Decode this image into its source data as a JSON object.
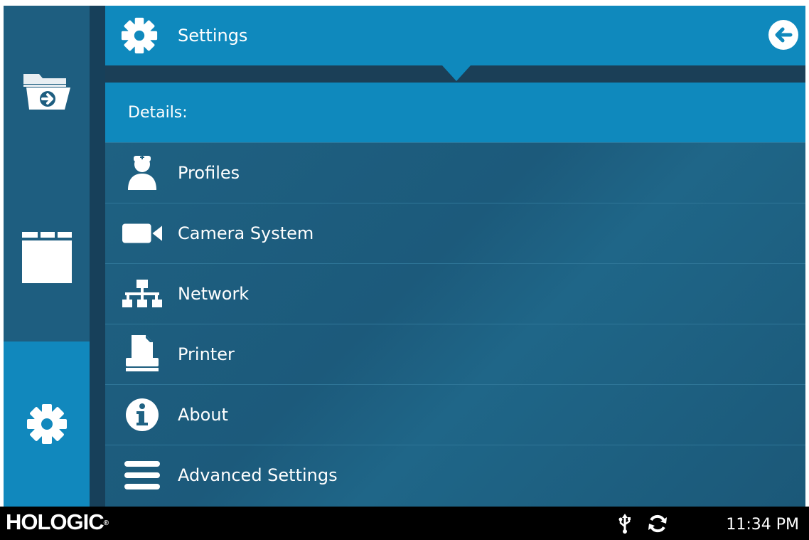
{
  "header": {
    "title": "Settings",
    "icon": "gear-icon",
    "back_icon": "back-arrow-icon"
  },
  "sidebar": {
    "items": [
      {
        "name": "open-folder",
        "icon": "folder-open-icon"
      },
      {
        "name": "folder",
        "icon": "folder-icon"
      },
      {
        "name": "settings",
        "icon": "gear-icon",
        "active": true
      }
    ]
  },
  "main": {
    "section_label": "Details:",
    "items": [
      {
        "label": "Profiles",
        "icon": "user-profile-icon"
      },
      {
        "label": "Camera System",
        "icon": "camera-icon"
      },
      {
        "label": "Network",
        "icon": "network-icon"
      },
      {
        "label": "Printer",
        "icon": "printer-icon"
      },
      {
        "label": "About",
        "icon": "info-icon"
      },
      {
        "label": "Advanced Settings",
        "icon": "menu-lines-icon"
      }
    ]
  },
  "footer": {
    "brand": "HOLOGIC",
    "brand_mark": "®",
    "time": "11:34 PM",
    "usb_icon": "usb-icon",
    "sync_icon": "sync-icon"
  },
  "colors": {
    "accent": "#0f89bd",
    "panel": "#1f6283",
    "sidebar": "#1e5e80",
    "footer": "#000000"
  }
}
